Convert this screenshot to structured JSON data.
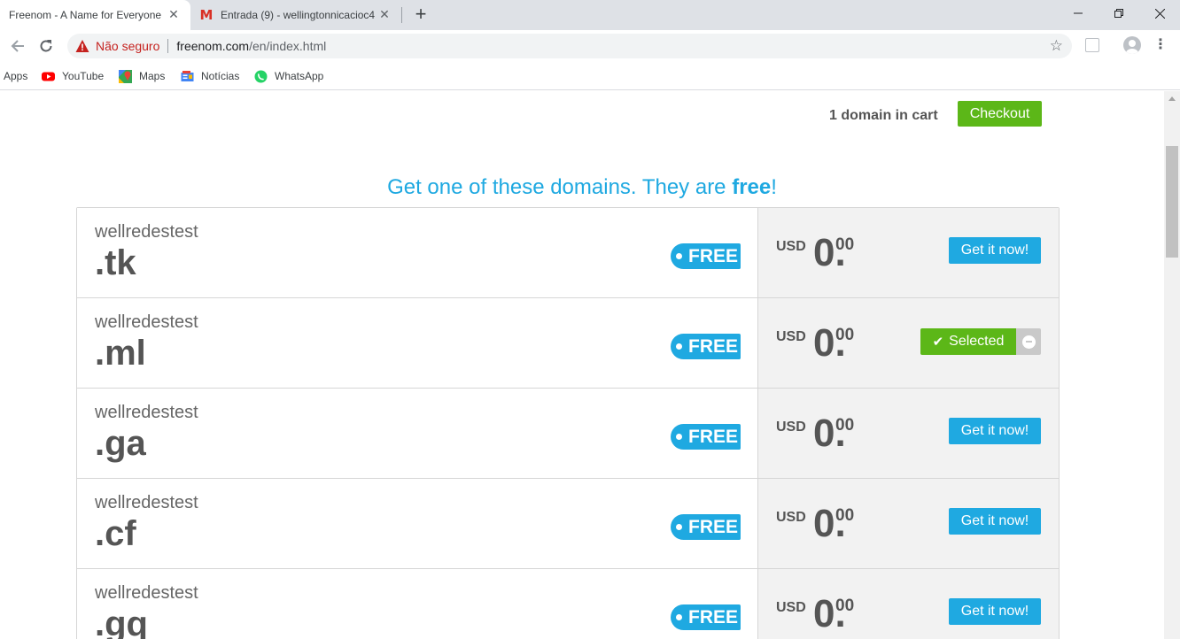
{
  "browser": {
    "tabs": [
      {
        "title": "Freenom - A Name for Everyone",
        "active": true
      },
      {
        "title": "Entrada (9) - wellingtonnicacioc4",
        "active": false
      }
    ],
    "new_tab_label": "+",
    "security_label": "Não seguro",
    "url_host": "freenom.com",
    "url_path": "/en/index.html",
    "bookmarks": [
      {
        "label": "Apps",
        "icon": "apps-grid-icon"
      },
      {
        "label": "YouTube",
        "icon": "youtube-icon"
      },
      {
        "label": "Maps",
        "icon": "maps-icon"
      },
      {
        "label": "Notícias",
        "icon": "news-icon"
      },
      {
        "label": "WhatsApp",
        "icon": "whatsapp-icon"
      }
    ]
  },
  "cart": {
    "summary": "1 domain in cart",
    "checkout_label": "Checkout"
  },
  "heading": {
    "prefix": "Get one of these domains. They are ",
    "emphasis": "free",
    "suffix": "!"
  },
  "domains": [
    {
      "name": "wellredestest",
      "tld": ".tk",
      "badge": "FREE",
      "currency": "USD",
      "price_int": "0.",
      "price_dec": "00",
      "state": "available",
      "action_label": "Get it now!"
    },
    {
      "name": "wellredestest",
      "tld": ".ml",
      "badge": "FREE",
      "currency": "USD",
      "price_int": "0.",
      "price_dec": "00",
      "state": "selected",
      "action_label": "Selected"
    },
    {
      "name": "wellredestest",
      "tld": ".ga",
      "badge": "FREE",
      "currency": "USD",
      "price_int": "0.",
      "price_dec": "00",
      "state": "available",
      "action_label": "Get it now!"
    },
    {
      "name": "wellredestest",
      "tld": ".cf",
      "badge": "FREE",
      "currency": "USD",
      "price_int": "0.",
      "price_dec": "00",
      "state": "available",
      "action_label": "Get it now!"
    },
    {
      "name": "wellredestest",
      "tld": ".gq",
      "badge": "FREE",
      "currency": "USD",
      "price_int": "0.",
      "price_dec": "00",
      "state": "available",
      "action_label": "Get it now!"
    }
  ],
  "colors": {
    "brand_blue": "#1fa9e1",
    "brand_green": "#5cb718",
    "insecure_red": "#c5221f"
  }
}
